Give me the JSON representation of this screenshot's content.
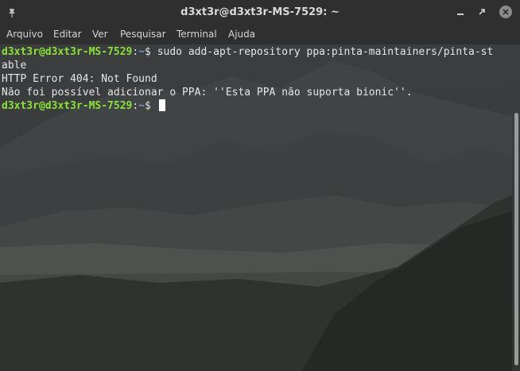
{
  "window": {
    "title": "d3xt3r@d3xt3r-MS-7529: ~",
    "icons": {
      "pin": "pin-icon",
      "minimize": "minimize-icon",
      "maximize": "maximize-icon",
      "close": "close-icon"
    }
  },
  "menu": {
    "items": [
      "Arquivo",
      "Editar",
      "Ver",
      "Pesquisar",
      "Terminal",
      "Ajuda"
    ]
  },
  "terminal": {
    "prompt_user": "d3xt3r@d3xt3r-MS-7529",
    "prompt_sep": ":",
    "prompt_path": "~",
    "prompt_symbol": "$ ",
    "command": "sudo add-apt-repository ppa:pinta-maintainers/pinta-stable",
    "output": [
      "HTTP Error 404: Not Found",
      "Não foi possível adicionar o PPA: ''Esta PPA não suporta bionic''."
    ],
    "colors": {
      "user": "#8ae234",
      "path": "#6d9fd6",
      "text": "#e6e6e6"
    }
  }
}
